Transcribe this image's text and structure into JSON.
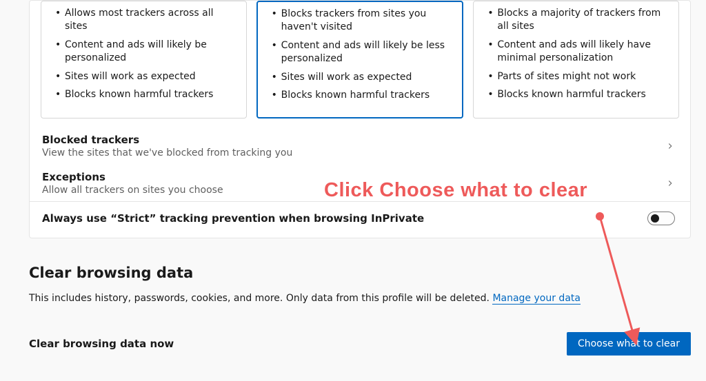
{
  "tracking": {
    "levels": {
      "basic": {
        "items": [
          "Allows most trackers across all sites",
          "Content and ads will likely be personalized",
          "Sites will work as expected",
          "Blocks known harmful trackers"
        ]
      },
      "balanced": {
        "items": [
          "Blocks trackers from sites you haven't visited",
          "Content and ads will likely be less personalized",
          "Sites will work as expected",
          "Blocks known harmful trackers"
        ]
      },
      "strict": {
        "items": [
          "Blocks a majority of trackers from all sites",
          "Content and ads will likely have minimal personalization",
          "Parts of sites might not work",
          "Blocks known harmful trackers"
        ]
      }
    },
    "blocked_trackers": {
      "title": "Blocked trackers",
      "subtitle": "View the sites that we've blocked from tracking you"
    },
    "exceptions": {
      "title": "Exceptions",
      "subtitle": "Allow all trackers on sites you choose"
    },
    "strict_inprivate": {
      "title": "Always use “Strict” tracking prevention when browsing InPrivate"
    }
  },
  "clear_data": {
    "heading": "Clear browsing data",
    "description_prefix": "This includes history, passwords, cookies, and more. Only data from this profile will be deleted. ",
    "link": "Manage your data",
    "now_title": "Clear browsing data now",
    "button": "Choose what to clear"
  },
  "annotation": {
    "text": "Click Choose what to clear"
  }
}
